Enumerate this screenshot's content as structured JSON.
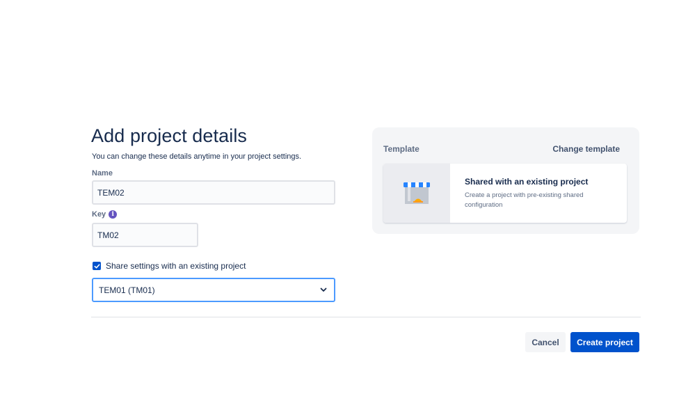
{
  "header": {
    "title": "Add project details",
    "subtitle": "You can change these details anytime in your project settings."
  },
  "form": {
    "name_label": "Name",
    "name_value": "TEM02",
    "key_label": "Key",
    "key_value": "TM02",
    "share_label": "Share settings with an existing project",
    "share_checked": true,
    "share_project_selected": "TEM01 (TM01)"
  },
  "template": {
    "label": "Template",
    "change_label": "Change template",
    "card_title": "Shared with an existing project",
    "card_description": "Create a project with pre-existing shared configuration",
    "thumbnail_icon": "store-awning-icon"
  },
  "actions": {
    "cancel_label": "Cancel",
    "create_label": "Create project"
  },
  "colors": {
    "primary": "#0052cc",
    "focus_border": "#4c9aff",
    "text": "#172b4d",
    "subtle_text": "#5e6c84",
    "info_icon": "#6554c0"
  }
}
